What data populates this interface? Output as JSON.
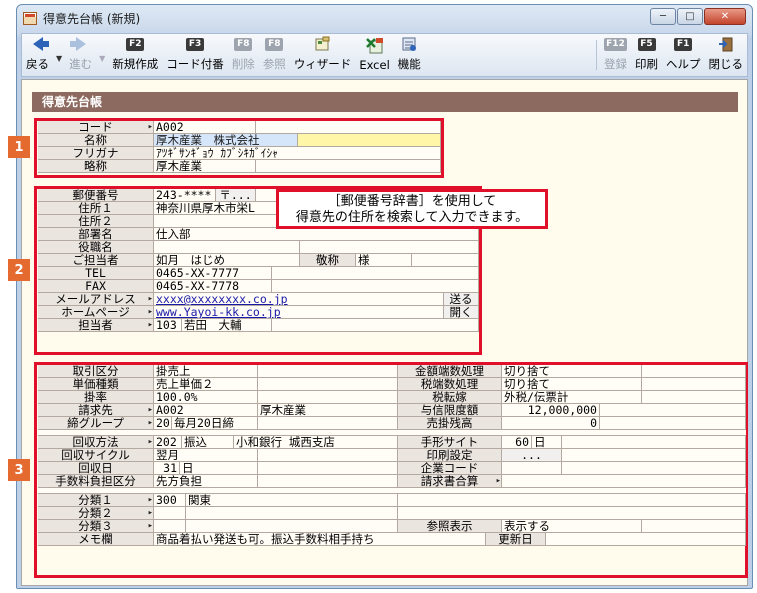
{
  "window": {
    "title": "得意先台帳 (新規)",
    "buttons": {
      "minimize": "─",
      "maximize": "□",
      "close": "✕"
    }
  },
  "toolbar": {
    "back": "戻る",
    "forward": "進む",
    "new": {
      "key": "F2",
      "label": "新規作成"
    },
    "code": {
      "key": "F3",
      "label": "コード付番"
    },
    "delete": {
      "key": "F8",
      "label": "削除"
    },
    "reference": {
      "key": "F8",
      "label": "参照"
    },
    "wizard": "ウィザード",
    "excel": "Excel",
    "features": "機能",
    "register": {
      "key": "F12",
      "label": "登録"
    },
    "print": {
      "key": "F5",
      "label": "印刷"
    },
    "help": {
      "key": "F1",
      "label": "ヘルプ"
    },
    "close": "閉じる"
  },
  "section_title": "得意先台帳",
  "badges": [
    "1",
    "2",
    "3"
  ],
  "callout": {
    "line1": "［郵便番号辞書］を使用して",
    "line2": "得意先の住所を検索して入力できます。"
  },
  "sec1": {
    "code_label": "コード",
    "code": "A002",
    "name_label": "名称",
    "name": "厚木産業　株式会社",
    "furigana_label": "フリガナ",
    "furigana": "ｱﾂｷﾞｻﾝｷﾞｮｳ ｶﾌﾞｼｷｶﾞｲｼｬ",
    "short_label": "略称",
    "short": "厚木産業"
  },
  "sec2": {
    "zip_label": "郵便番号",
    "zip": "243-****",
    "zip_btn": "〒...",
    "addr1_label": "住所１",
    "addr1": "神奈川県厚木市栄L",
    "addr2_label": "住所２",
    "addr2": "",
    "dept_label": "部署名",
    "dept": "仕入部",
    "title_label": "役職名",
    "title": "",
    "contact_label": "ご担当者",
    "contact": "如月　はじめ",
    "honorific_label": "敬称",
    "honorific": "様",
    "tel_label": "TEL",
    "tel": "0465-XX-7777",
    "fax_label": "FAX",
    "fax": "0465-XX-7778",
    "mail_label": "メールアドレス",
    "mail": "xxxx@xxxxxxxx.co.jp",
    "mail_btn": "送る",
    "web_label": "ホームページ",
    "web": "www.Yayoi-kk.co.jp",
    "web_btn": "開く",
    "staff_label": "担当者",
    "staff_code": "103",
    "staff": "若田　大輔"
  },
  "sec3": {
    "trade_label": "取引区分",
    "trade": "掛売上",
    "round_label": "金額端数処理",
    "round": "切り捨て",
    "price_label": "単価種類",
    "price": "売上単価２",
    "tax_round_label": "税端数処理",
    "tax_round": "切り捨て",
    "rate_label": "掛率",
    "rate": "100.0%",
    "tax_label": "税転嫁",
    "tax": "外税/伝票計",
    "bill_label": "請求先",
    "bill_code": "A002",
    "bill_name": "厚木産業",
    "credit_label": "与信限度額",
    "credit": "12,000,000",
    "close_group_label": "締グループ",
    "close_group_code": "20",
    "close_group": "毎月20日締",
    "balance_label": "売掛残高",
    "balance": "0",
    "method_label": "回収方法",
    "method_code": "202",
    "method": "振込",
    "bank": "小和銀行 城西支店",
    "site_label": "手形サイト",
    "site": "60",
    "site_unit": "日",
    "cycle_label": "回収サイクル",
    "cycle": "翌月",
    "print_label": "印刷設定",
    "print_btn": "...",
    "day_label": "回収日",
    "day": "31",
    "day_unit": "日",
    "company_label": "企業コード",
    "company": "",
    "fee_label": "手数料負担区分",
    "fee": "先方負担",
    "invoice_label": "請求書合算",
    "invoice": "",
    "cls1_label": "分類１",
    "cls1_code": "300",
    "cls1": "関東",
    "cls2_label": "分類２",
    "cls3_label": "分類３",
    "ref_label": "参照表示",
    "ref": "表示する",
    "memo_label": "メモ欄",
    "memo": "商品着払い発送も可。振込手数料相手持ち",
    "updated_label": "更新日",
    "updated": ""
  }
}
